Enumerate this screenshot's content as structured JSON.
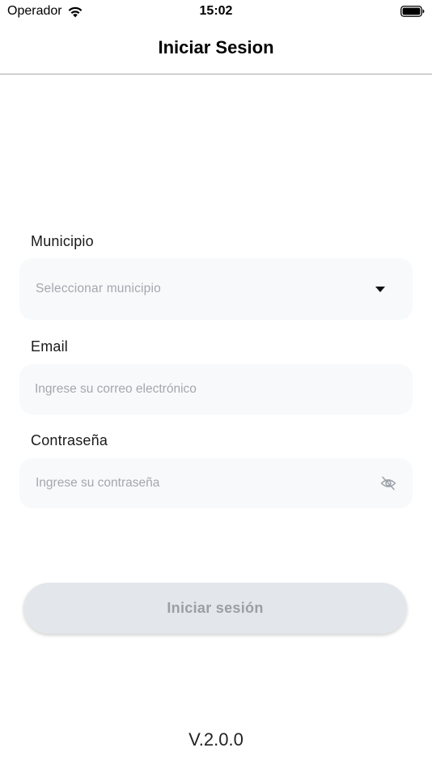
{
  "status_bar": {
    "carrier": "Operador",
    "time": "15:02"
  },
  "header": {
    "title": "Iniciar Sesion"
  },
  "form": {
    "municipio": {
      "label": "Municipio",
      "placeholder": "Seleccionar municipio"
    },
    "email": {
      "label": "Email",
      "placeholder": "Ingrese su correo electrónico"
    },
    "password": {
      "label": "Contraseña",
      "placeholder": "Ingrese su contraseña"
    }
  },
  "login_button": {
    "label": "Iniciar sesión"
  },
  "footer": {
    "version": "V.2.0.0"
  },
  "icons": {
    "wifi": "wifi-icon",
    "battery": "battery-icon",
    "dropdown": "chevron-down-icon",
    "toggle_password": "eye-slash-icon"
  },
  "colors": {
    "field_background": "#f8f9fb",
    "placeholder": "#a3a7ad",
    "button_background": "#e3e6ea",
    "button_text": "#9a9fa6"
  }
}
